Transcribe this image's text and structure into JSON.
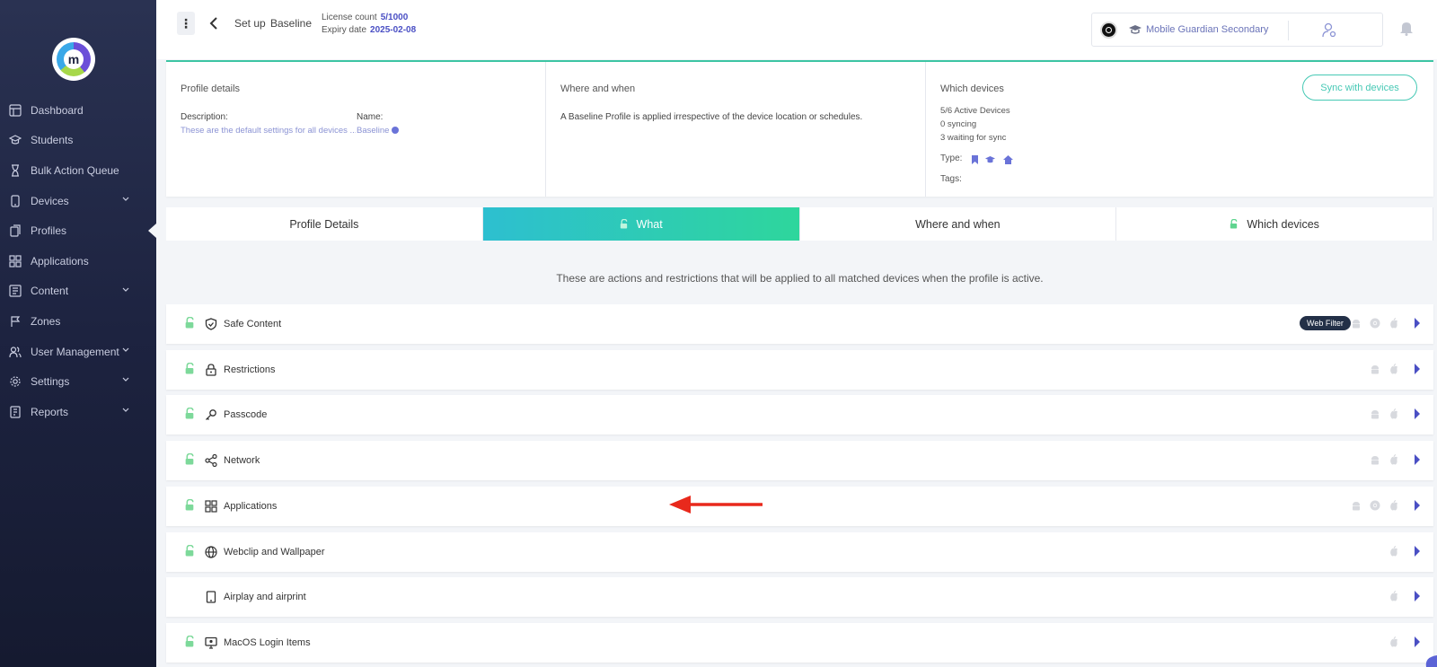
{
  "sidebar": {
    "items": [
      {
        "label": "Dashboard",
        "icon": "dashboard-icon",
        "expandable": false
      },
      {
        "label": "Students",
        "icon": "graduation-cap-icon",
        "expandable": false
      },
      {
        "label": "Bulk Action Queue",
        "icon": "hourglass-icon",
        "expandable": false
      },
      {
        "label": "Devices",
        "icon": "phone-icon",
        "expandable": true
      },
      {
        "label": "Profiles",
        "icon": "profiles-icon",
        "expandable": false,
        "active": true
      },
      {
        "label": "Applications",
        "icon": "apps-grid-icon",
        "expandable": false
      },
      {
        "label": "Content",
        "icon": "content-icon",
        "expandable": true
      },
      {
        "label": "Zones",
        "icon": "zones-icon",
        "expandable": false
      },
      {
        "label": "User Management",
        "icon": "users-icon",
        "expandable": true
      },
      {
        "label": "Settings",
        "icon": "gear-icon",
        "expandable": true
      },
      {
        "label": "Reports",
        "icon": "reports-icon",
        "expandable": true
      }
    ]
  },
  "header": {
    "breadcrumb_setup": "Set up",
    "breadcrumb_profile": "Baseline",
    "license_label": "License count",
    "license_value": "5/1000",
    "expiry_label": "Expiry date",
    "expiry_value": "2025-02-08",
    "account_name": "Mobile Guardian Secondary"
  },
  "info": {
    "profile_details_title": "Profile details",
    "description_label": "Description:",
    "description_value": "These are the default settings for all devices ...",
    "name_label": "Name:",
    "name_value": "Baseline",
    "where_when_title": "Where and when",
    "where_when_text": "A Baseline Profile is applied irrespective of the device location or schedules.",
    "which_devices_title": "Which devices",
    "active_devices": "5/6 Active Devices",
    "syncing": "0 syncing",
    "waiting": "3 waiting for sync",
    "type_label": "Type:",
    "tags_label": "Tags:",
    "sync_button": "Sync with devices"
  },
  "tabs": [
    {
      "label": "Profile Details",
      "lock": false,
      "active": false
    },
    {
      "label": "What",
      "lock": true,
      "active": true
    },
    {
      "label": "Where and when",
      "lock": false,
      "active": false
    },
    {
      "label": "Which devices",
      "lock": true,
      "active": false
    }
  ],
  "notice": "These are actions and restrictions that will be applied to all matched devices when the profile is active.",
  "rows": [
    {
      "label": "Safe Content",
      "icon": "shield-icon",
      "lock": true,
      "badge": "Web Filter",
      "platforms": [
        "android",
        "chrome",
        "apple"
      ]
    },
    {
      "label": "Restrictions",
      "icon": "padlock-icon",
      "lock": true,
      "platforms": [
        "android",
        "apple"
      ]
    },
    {
      "label": "Passcode",
      "icon": "key-icon",
      "lock": true,
      "platforms": [
        "android",
        "apple"
      ]
    },
    {
      "label": "Network",
      "icon": "share-network-icon",
      "lock": true,
      "platforms": [
        "android",
        "apple"
      ]
    },
    {
      "label": "Applications",
      "icon": "apps-grid-icon",
      "lock": true,
      "platforms": [
        "android",
        "chrome",
        "apple"
      ]
    },
    {
      "label": "Webclip and Wallpaper",
      "icon": "globe-icon",
      "lock": true,
      "platforms": [
        "apple"
      ]
    },
    {
      "label": "Airplay and airprint",
      "icon": "tablet-icon",
      "lock": false,
      "platforms": [
        "apple"
      ]
    },
    {
      "label": "MacOS Login Items",
      "icon": "monitor-icon",
      "lock": true,
      "platforms": [
        "apple"
      ]
    }
  ],
  "colors": {
    "accent_teal": "#3cc5a3",
    "accent_blue": "#4a4fc4",
    "sidebar_bg": "#1d2340",
    "annotation_arrow": "#e8291c"
  }
}
